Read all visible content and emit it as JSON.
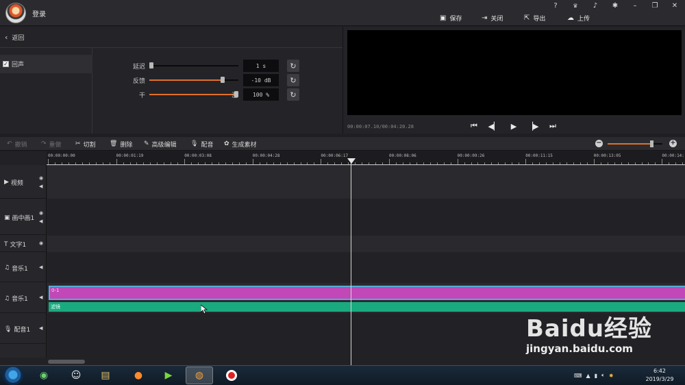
{
  "topbar": {
    "login_label": "登录",
    "window_controls": [
      "?",
      "VIP",
      "bell-icon",
      "gear-icon",
      "minimize",
      "restore",
      "close"
    ],
    "actions": {
      "save": "保存",
      "close": "关闭",
      "export": "导出",
      "upload": "上传"
    }
  },
  "effect": {
    "back_label": "返回",
    "item_label": "回声",
    "item_checked": true,
    "delete_label": "删除",
    "clear_label": "清空",
    "params": [
      {
        "label": "延迟",
        "value": "1 s",
        "fraction": 0.02
      },
      {
        "label": "反馈",
        "value": "-10 dB",
        "fraction": 0.82
      },
      {
        "label": "干",
        "right_label": "湿",
        "value": "100 %",
        "fraction": 0.98
      }
    ]
  },
  "preview": {
    "timecode": "00:00:07.10/00:04:20.28"
  },
  "toolbar": {
    "undo": "撤销",
    "redo": "重做",
    "cut": "切割",
    "delete": "删除",
    "advanced_edit": "高级编辑",
    "dub": "配音",
    "generate": "生成素材",
    "zoom_level": 0.8
  },
  "timeline": {
    "ticks": [
      "00:00:00:00",
      "00:00:01:19",
      "00:00:03:08",
      "00:00:04:28",
      "00:00:06:17",
      "00:00:08:06",
      "00:00:09:26",
      "00:00:11:15",
      "00:00:13:05",
      "00:00:14:"
    ],
    "tracks": [
      {
        "name": "视频",
        "icon": "play-icon"
      },
      {
        "name": "画中画1",
        "icon": "pip-icon"
      },
      {
        "name": "文字1",
        "icon": "text-icon"
      },
      {
        "name": "音乐1",
        "icon": "music-icon"
      },
      {
        "name": "音乐1",
        "icon": "music-icon"
      },
      {
        "name": "配音1",
        "icon": "mic-icon"
      }
    ],
    "audio_clip_label": "0-1",
    "effect_clip_label": "滤镜"
  },
  "taskbar": {
    "time": "6:42",
    "date": "2019/3/29"
  },
  "watermark": {
    "logo": "Baidu经验",
    "url": "jingyan.baidu.com"
  }
}
